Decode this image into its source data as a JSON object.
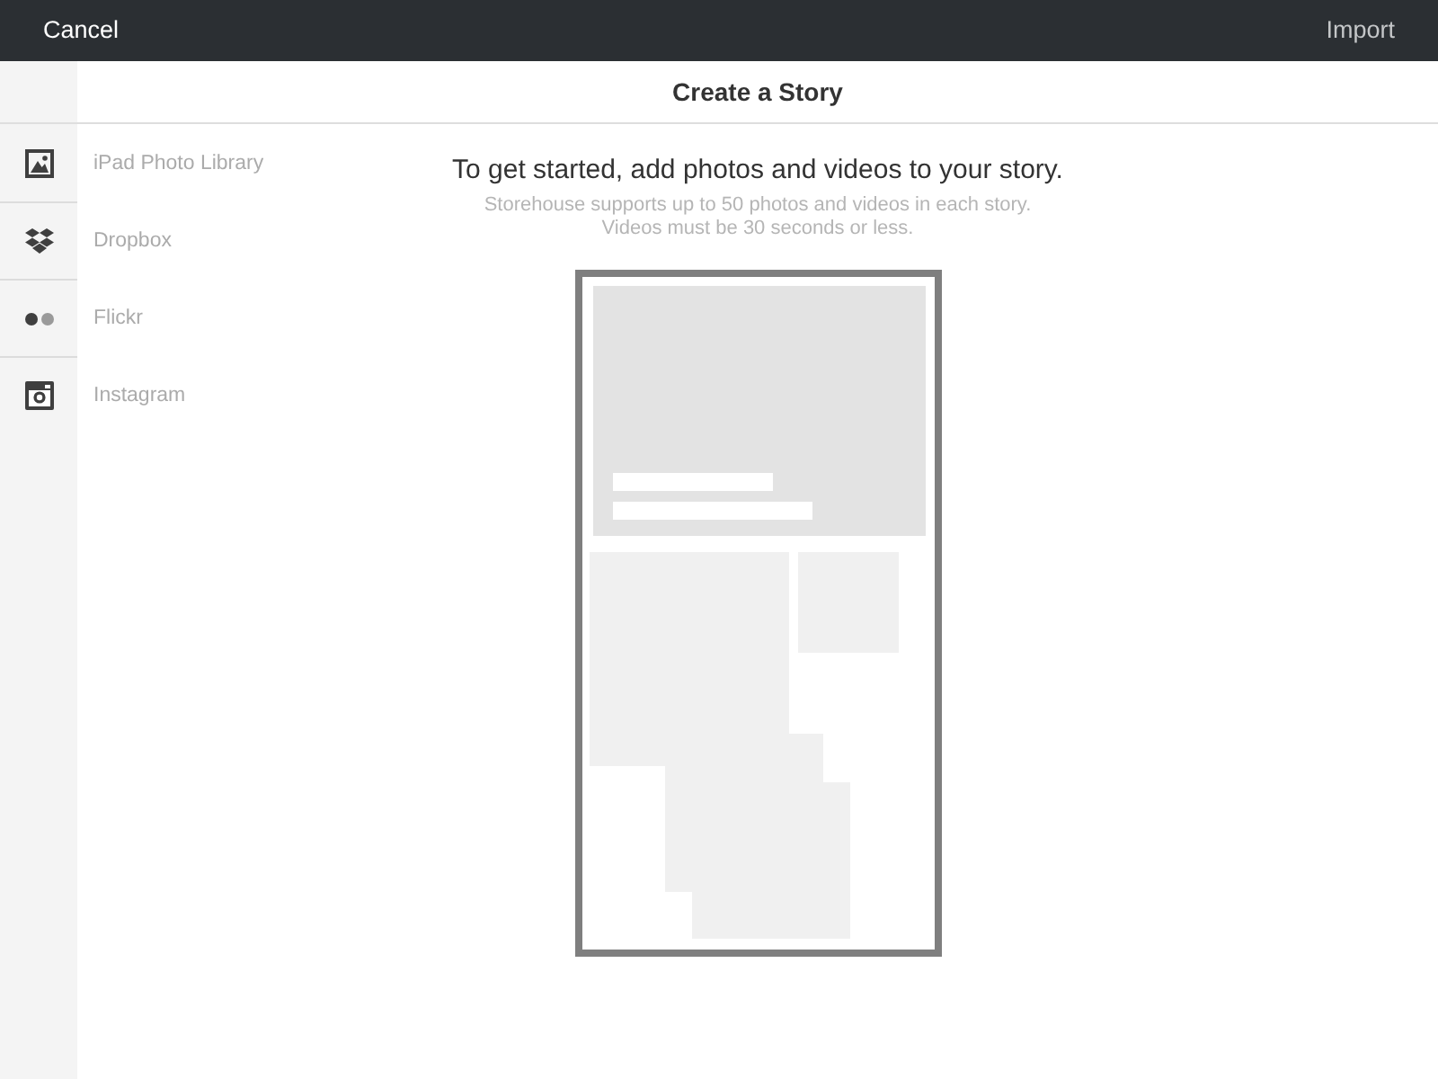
{
  "top_bar": {
    "cancel": {
      "label": "Cancel"
    },
    "import": {
      "label": "Import",
      "disabled": true
    }
  },
  "header": {
    "title": "Create a Story"
  },
  "sources": [
    {
      "kind": "image",
      "label": "iPad Photo Library"
    },
    {
      "kind": "diamonds",
      "label": "Dropbox"
    },
    {
      "kind": "dots",
      "label": "Flickr"
    },
    {
      "kind": "camera",
      "label": "Instagram"
    }
  ],
  "intro": {
    "heading": "To get started, add photos and videos to your story.",
    "note_lines": [
      "Storehouse supports up to 50 photos and videos in each story.",
      "Videos must be 30 seconds or less."
    ]
  }
}
